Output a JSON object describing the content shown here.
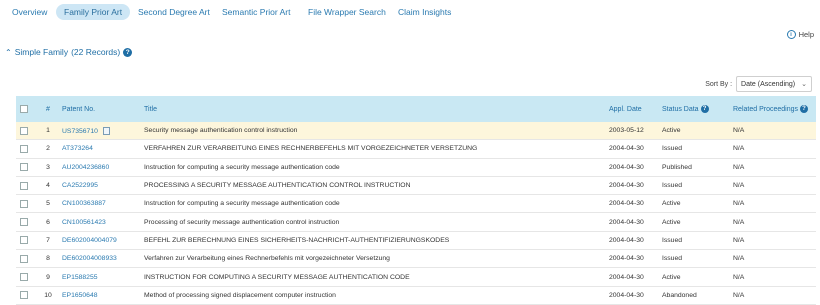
{
  "nav": {
    "tabs": [
      "Overview",
      "Family Prior Art",
      "Second Degree Art",
      "Semantic Prior Art",
      "File Wrapper Search",
      "Claim Insights"
    ],
    "active_index": 1
  },
  "help": {
    "label": "Help",
    "icon": "info-icon"
  },
  "section": {
    "title": "Simple Family",
    "count": "(22 Records)",
    "icon": "question-icon"
  },
  "sort": {
    "label": "Sort By :",
    "value": "Date (Ascending)"
  },
  "table": {
    "headers": {
      "num": "#",
      "patent": "Patent No.",
      "title": "Title",
      "date": "Appl. Date",
      "status": "Status Data",
      "related": "Related Proceedings"
    },
    "rows": [
      {
        "n": "1",
        "patent": "US7356710",
        "title": "Security message authentication control instruction",
        "date": "2003-05-12",
        "status": "Active",
        "related": "N/A",
        "highlight": true,
        "doc": true
      },
      {
        "n": "2",
        "patent": "AT373264",
        "title": "VERFAHREN ZUR VERARBEITUNG EINES RECHNERBEFEHLS MIT VORGEZEICHNETER VERSETZUNG",
        "date": "2004-04-30",
        "status": "Issued",
        "related": "N/A"
      },
      {
        "n": "3",
        "patent": "AU2004236860",
        "title": "Instruction for computing a security message authentication code",
        "date": "2004-04-30",
        "status": "Published",
        "related": "N/A"
      },
      {
        "n": "4",
        "patent": "CA2522995",
        "title": "PROCESSING A SECURITY MESSAGE AUTHENTICATION CONTROL INSTRUCTION",
        "date": "2004-04-30",
        "status": "Issued",
        "related": "N/A"
      },
      {
        "n": "5",
        "patent": "CN100363887",
        "title": "Instruction for computing a security message authentication code",
        "date": "2004-04-30",
        "status": "Active",
        "related": "N/A"
      },
      {
        "n": "6",
        "patent": "CN100561423",
        "title": "Processing of security message authentication control instruction",
        "date": "2004-04-30",
        "status": "Active",
        "related": "N/A"
      },
      {
        "n": "7",
        "patent": "DE602004004079",
        "title": "BEFEHL ZUR BERECHNUNG EINES SICHERHEITS-NACHRICHT-AUTHENTIFIZIERUNGSKODES",
        "date": "2004-04-30",
        "status": "Issued",
        "related": "N/A"
      },
      {
        "n": "8",
        "patent": "DE602004008933",
        "title": "Verfahren zur Verarbeitung eines Rechnerbefehls mit vorgezeichneter Versetzung",
        "date": "2004-04-30",
        "status": "Issued",
        "related": "N/A"
      },
      {
        "n": "9",
        "patent": "EP1588255",
        "title": "INSTRUCTION FOR COMPUTING A SECURITY MESSAGE AUTHENTICATION CODE",
        "date": "2004-04-30",
        "status": "Active",
        "related": "N/A"
      },
      {
        "n": "10",
        "patent": "EP1650648",
        "title": "Method of processing signed displacement computer instruction",
        "date": "2004-04-30",
        "status": "Abandoned",
        "related": "N/A"
      }
    ]
  }
}
